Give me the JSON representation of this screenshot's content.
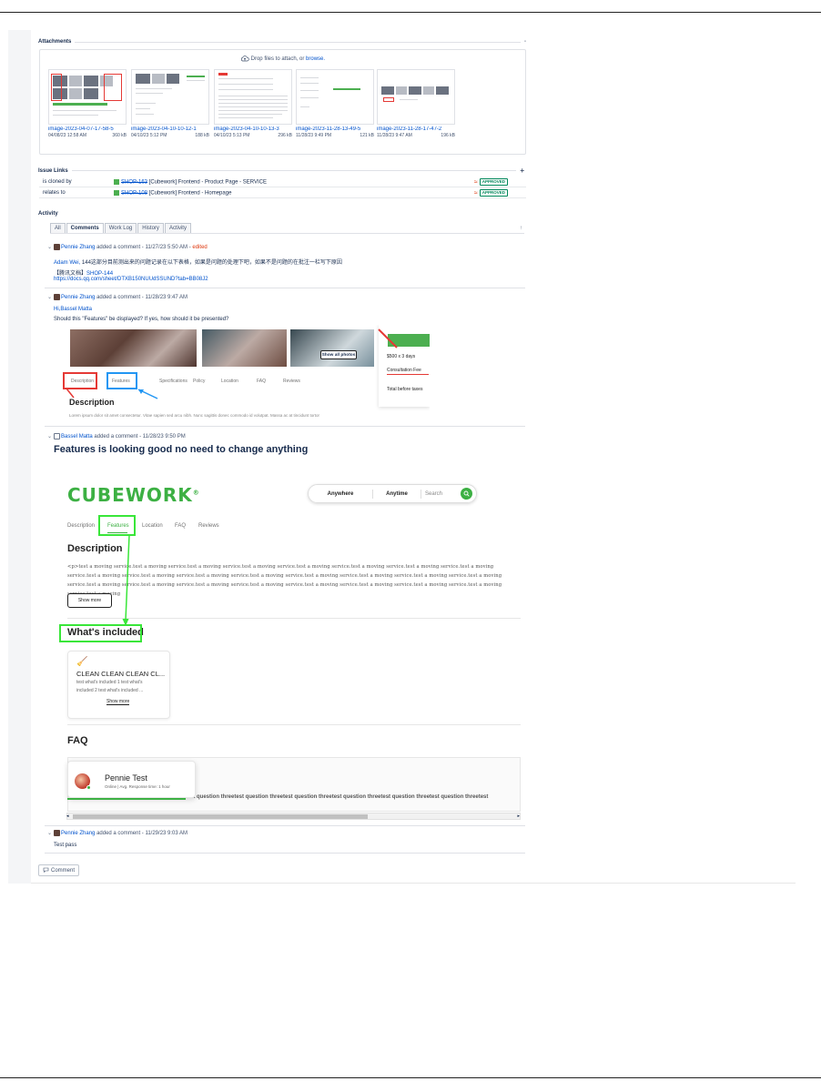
{
  "attachments": {
    "heading": "Attachments",
    "drop_text": "Drop files to attach, or",
    "browse": "browse.",
    "files": [
      {
        "name": "image-2023-04-07-17-58-5",
        "date": "04/08/23 12:58 AM",
        "size": "360 kB"
      },
      {
        "name": "image-2023-04-10-10-12-1",
        "date": "04/10/23 5:12 PM",
        "size": "188 kB"
      },
      {
        "name": "image-2023-04-10-10-13-3",
        "date": "04/10/23 5:13 PM",
        "size": "296 kB"
      },
      {
        "name": "image-2023-11-28-13-49-5",
        "date": "11/28/23 9:49 PM",
        "size": "121 kB"
      },
      {
        "name": "image-2023-11-28-17-47-2",
        "date": "11/28/23 9:47 AM",
        "size": "196 kB"
      }
    ]
  },
  "issue_links": {
    "heading": "Issue Links",
    "rows": [
      {
        "relation": "is cloned by",
        "key": "SHOP-163",
        "summary": "[Cubework] Frontend - Product Page - SERVICE",
        "status": "APPROVED"
      },
      {
        "relation": "relates to",
        "key": "SHOP-108",
        "summary": "[Cubework] Frontend - Homepage",
        "status": "APPROVED"
      }
    ]
  },
  "activity": {
    "heading": "Activity",
    "tabs": [
      "All",
      "Comments",
      "Work Log",
      "History",
      "Activity"
    ],
    "active_tab": "Comments"
  },
  "comments": [
    {
      "author": "Pennie Zhang",
      "action": "added a comment -",
      "time": "11/27/23 5:50 AM",
      "edited": "edited",
      "mention": "Adam Wei,",
      "body": "144这部分目前测出来的问题记录在以下表格，如果是问题的处理下吧，如果不是问题的在批注一栏写下原因",
      "doc_label": "【腾讯文档】",
      "doc_link_text": "SHOP-144",
      "url": "https://docs.qq.com/sheet/DTXB150NUUdSSUND?tab=BB08J2"
    },
    {
      "author": "Pennie Zhang",
      "action": "added a comment -",
      "time": "11/28/23 9:47 AM",
      "mention": "Hi,Bassel Matta",
      "body": "Should this \"Features\" be displayed? If yes, how should it be presented?"
    },
    {
      "author": "Bassel Matta",
      "action": "added a comment -",
      "time": "11/28/23 9:50 PM",
      "body": "Features is looking good no need to change anything"
    },
    {
      "author": "Pennie Zhang",
      "action": "added a comment -",
      "time": "11/29/23 9:03 AM",
      "body": "Test pass"
    }
  ],
  "shot1": {
    "show_all_photos": "Show all photos",
    "price": "$500 x 3 days",
    "consult": "Consultation Fee",
    "total": "Total before taxes",
    "tabs": [
      "Description",
      "Features",
      "Specifications",
      "Policy",
      "Location",
      "FAQ",
      "Reviews"
    ],
    "heading": "Description",
    "lorem": "Lorem ipsum dolor sit amet consectetur. Vitae sapien sed arcu nibh. Nunc sagittis donec commodo id volutpat. Massa ac at tincidunt tortor"
  },
  "shot2": {
    "logo": "CUBEWORK",
    "logo_mark": "®",
    "search": {
      "anywhere": "Anywhere",
      "anytime": "Anytime",
      "placeholder": "Search"
    },
    "tabs": [
      "Description",
      "Features",
      "Location",
      "FAQ",
      "Reviews"
    ],
    "desc_heading": "Description",
    "desc_text": "<p>test a moving service.test a moving service.test a moving service.test a moving service.test a moving service.test a moving service.test a moving service.test a moving service.test a moving service.test a moving service.test a moving service.test a moving service.test a moving service.test a moving service.test a moving service.test a moving service.test a moving service.test a moving service.test a moving service.test a moving service.test a moving service.test a moving service.test a moving service.test a moving service.test a moving",
    "show_more": "Show more",
    "included_heading": "What's included",
    "card_title": "CLEAN CLEAN CLEAN CL...",
    "card_text_1": "test what's included 1 test what's",
    "card_text_2": "included 2 test what's included ...",
    "card_show_more": "Show more",
    "faq_heading": "FAQ",
    "agent_name": "Pennie Test",
    "agent_status": "Online  |  Avg. Response time: 1 hour",
    "faq_q": "st question threetest question threetest question threetest question threetest question threetest question threetest"
  },
  "comment_button": "Comment",
  "colors": {
    "link": "#0052cc",
    "approved": "#00875a",
    "cube_green": "#3cb043",
    "annot_green": "#39e639",
    "annot_red": "#e53935",
    "annot_blue": "#2196f3"
  }
}
